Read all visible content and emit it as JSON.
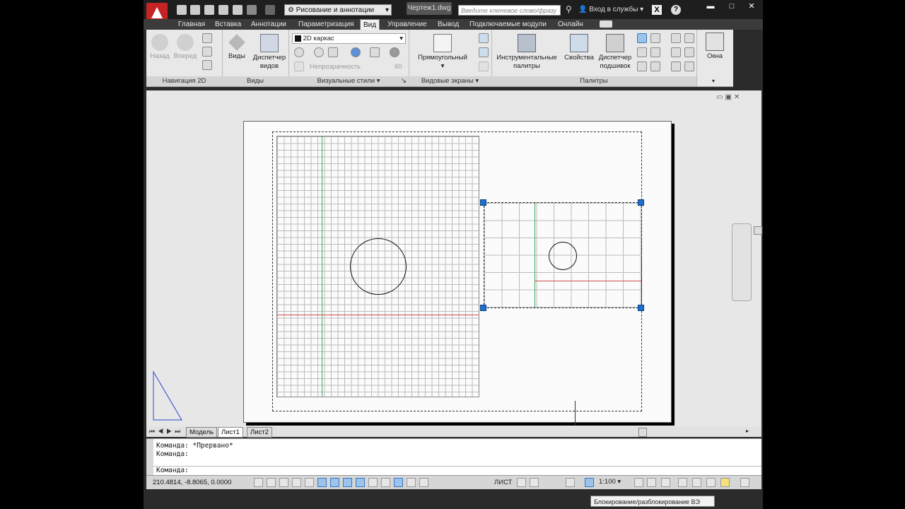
{
  "titlebar": {
    "workspace": "Рисование и аннотации",
    "document": "Чертеж1.dwg",
    "search_placeholder": "Введите ключевое слово/фразу",
    "signin": "Вход в службы"
  },
  "tabs": [
    "Главная",
    "Вставка",
    "Аннотации",
    "Параметризация",
    "Вид",
    "Управление",
    "Вывод",
    "Подключаемые модули",
    "Онлайн"
  ],
  "active_tab": "Вид",
  "ribbon": {
    "nav2d": {
      "back": "Назад",
      "forward": "Вперед",
      "title": "Навигация 2D"
    },
    "views": {
      "views": "Виды",
      "manager": "Диспетчер видов",
      "title": "Виды"
    },
    "visual": {
      "style": "2D каркас",
      "opacity_label": "Непрозрачность",
      "opacity_value": "60",
      "title": "Визуальные стили"
    },
    "viewports": {
      "rect": "Прямоугольный",
      "title": "Видовые экраны"
    },
    "palettes": {
      "tool": "Инструментальные палитры",
      "props": "Свойства",
      "sheetset": "Диспетчер подшивок",
      "title": "Палитры"
    },
    "window": {
      "label": "Окна"
    }
  },
  "layout_tabs": [
    "Модель",
    "Лист1",
    "Лист2"
  ],
  "active_layout": "Лист1",
  "command": {
    "line1": "Команда: *Прервано*",
    "line2": "Команда:",
    "line3": "Команда:"
  },
  "status": {
    "coords": "210.4814, -8.8065, 0.0000",
    "space": "ЛИСТ",
    "scale": "1:100",
    "tooltip": "Блокирование/разблокирование ВЭ"
  }
}
